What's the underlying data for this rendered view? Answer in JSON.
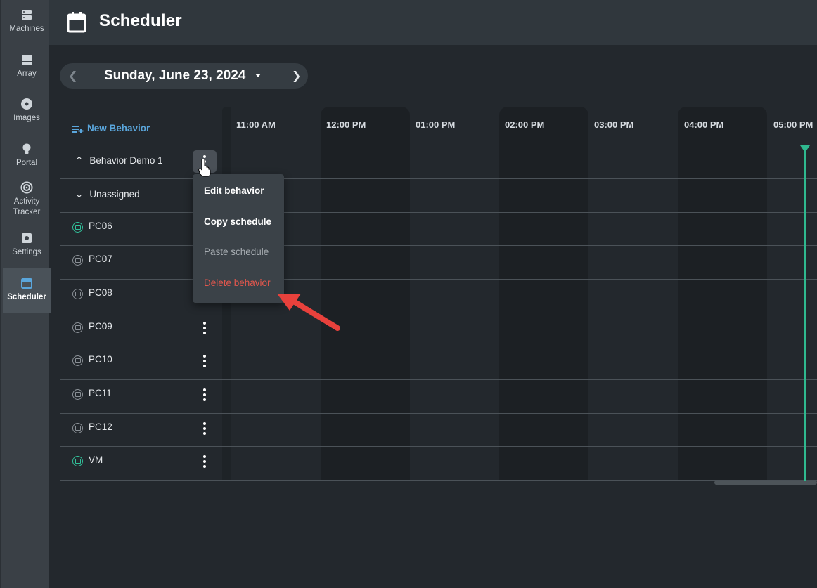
{
  "sidebar": {
    "items": [
      {
        "label": "Machines",
        "icon": "server-icon"
      },
      {
        "label": "Array",
        "icon": "array-icon"
      },
      {
        "label": "Images",
        "icon": "disc-icon"
      },
      {
        "label": "Portal",
        "icon": "lightbulb-icon"
      },
      {
        "label": "Activity Tracker",
        "icon": "radar-icon"
      },
      {
        "label": "Settings",
        "icon": "gear-icon"
      },
      {
        "label": "Scheduler",
        "icon": "calendar-icon",
        "active": true
      }
    ]
  },
  "header": {
    "title": "Scheduler"
  },
  "date_nav": {
    "date": "Sunday, June 23, 2024"
  },
  "list": {
    "new_behavior": "New Behavior",
    "groups": [
      {
        "label": "Behavior Demo 1",
        "expanded": true
      },
      {
        "label": "Unassigned",
        "expanded": false
      }
    ],
    "machines": [
      {
        "name": "PC06",
        "status": "online"
      },
      {
        "name": "PC07",
        "status": "offline"
      },
      {
        "name": "PC08",
        "status": "offline"
      },
      {
        "name": "PC09",
        "status": "offline"
      },
      {
        "name": "PC10",
        "status": "offline"
      },
      {
        "name": "PC11",
        "status": "offline"
      },
      {
        "name": "PC12",
        "status": "offline"
      },
      {
        "name": "VM",
        "status": "online"
      }
    ]
  },
  "timeline": {
    "times": [
      "11:00 AM",
      "12:00 PM",
      "01:00 PM",
      "02:00 PM",
      "03:00 PM",
      "04:00 PM",
      "05:00 PM"
    ]
  },
  "context_menu": {
    "items": [
      {
        "label": "Edit behavior",
        "state": "normal"
      },
      {
        "label": "Copy schedule",
        "state": "normal"
      },
      {
        "label": "Paste schedule",
        "state": "disabled"
      },
      {
        "label": "Delete behavior",
        "state": "danger"
      }
    ]
  },
  "colors": {
    "accent": "#5aa6dc",
    "online": "#32c29b",
    "danger": "#e4574d",
    "annotation_arrow": "#e8413c"
  }
}
